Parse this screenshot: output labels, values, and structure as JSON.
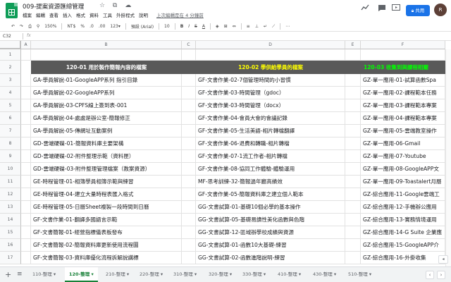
{
  "doc": {
    "title": "009-提案資源匯總管理",
    "title_icons": "☆ ⧉ ☁",
    "menus": [
      "檔案",
      "編輯",
      "查看",
      "插入",
      "格式",
      "資料",
      "工具",
      "外掛程式",
      "說明"
    ],
    "last_edit": "上次編輯是在 4 分鐘前",
    "share_label": "共用",
    "avatar_initial": "R"
  },
  "toolbar": {
    "undo": "↶",
    "redo": "↷",
    "print": "⎙",
    "paint": "⚲",
    "zoom": "150%",
    "currency": "NT$",
    "percent": "%",
    "dec_less": ".0",
    "dec_more": ".00",
    "format_more": "123▾",
    "font": "預設 (Arial)",
    "font_size": "10",
    "bold": "B",
    "italic": "I",
    "strike": "S",
    "text_color": "A",
    "more": "⋯"
  },
  "formula_bar": {
    "cell_ref": "C32",
    "fx": "fx"
  },
  "columns": [
    "A",
    "B",
    "C",
    "D",
    "E",
    "F"
  ],
  "rows": [
    "1",
    "2",
    "3",
    "4",
    "5",
    "6",
    "7",
    "8",
    "9",
    "10",
    "11",
    "12",
    "13",
    "14",
    "15",
    "16",
    "17"
  ],
  "headers": {
    "col_b": "120-01 用於製作簡報內容的檔案",
    "col_d": "120-02 學供給學員的檔案",
    "col_f": "120-03 收集到與課程相關"
  },
  "colors": {
    "header_bg": "#595959",
    "hdr_white": "#ffffff",
    "hdr_yellow": "#ffff00",
    "hdr_green": "#00ff00",
    "accent": "#188038",
    "share": "#1a73e8"
  },
  "table": [
    [
      "GA-學員解說-01-GoogleAPP系列 指引目錄",
      "GF-文書作業-02-7個管理時間的小習慣",
      "GZ-單一應用-01-試算函數Spa"
    ],
    [
      "GA-學員解說-02-GoogleAPP系列",
      "GF-文書作業-03-時間管理（gdoc）",
      "GZ-單一應用-02-課程範本任務"
    ],
    [
      "GA-學員解說-03-CPFS線上簽到表-001",
      "GF-文書作業-03-時間管理（docx）",
      "GZ-單一應用-03-課程範本專案"
    ],
    [
      "GA-學員解說-04-處處是辦公室-簡報修正",
      "GF-文書作業-04-會員大會的會議記錄",
      "GZ-單一應用-04-課程範本專案"
    ],
    [
      "GA-學員解說-05-傳網址互動案例",
      "GF-文書作業-05-生活美語-相片轉檔翻譯",
      "GZ-單一應用-05-雲端教室操作"
    ],
    [
      "GD-雲端硬碟-01-簡報資料庫主要架構",
      "GF-文書作業-06-退費和轉職-相片轉檔",
      "GZ-單一應用-06-Gmail"
    ],
    [
      "GD-雲端硬碟-02-附件整理示範（資料匣）",
      "GF-文書作業-07-1流工作者-相片轉檔",
      "GZ-單一應用-07-Youtube"
    ],
    [
      "GD-雲端硬碟-03-附件整理管理檔案（教案資源）",
      "GF-文書作業-08-協同工作體驗-體驗運用",
      "GZ-單一應用-08-GoogleAPP文"
    ],
    [
      "GE-時程管理-01-相簿學員相簿示範與練習",
      "MF-思考訓練-32-簡報過年廳高績效",
      "GZ-單一應用-09-Toastalert月曆"
    ],
    [
      "GE-時程管理-04-建立大量時程表匯入格式",
      "GF-文書作業-05-簡報資料庫之建立個人範本",
      "GZ-綜合應用-11-Google雲端工"
    ],
    [
      "GE-時程管理-05-日曆Sheet複製一段時間到日曆",
      "GG-文書試算-01-基礎10個必學的基本操作",
      "GZ-綜合應用-12-手機辦公應用"
    ],
    [
      "GF-文書作業-01-翻譯多國語言示範",
      "GG-文書試算-05-基礎易讀性美化函數與色階",
      "GZ-綜合應用-13-實務情境運用"
    ],
    [
      "GF-文書簡報-01-經營指標儀表板發布",
      "GG-文書試算-12-區域辦學校成績與資源",
      "GZ-綜合應用-14-G Suite 企業應"
    ],
    [
      "GF-文書簡報-02-簡報資料庫更新使用流程圖",
      "GG-文書試算-01-函數10大基礎-練習",
      "GZ-綜合應用-15-GoogleAPP介"
    ],
    [
      "GF-文書簡報-03-資料庫優化流程拆解說講標",
      "GG-文書試算-02-函數進階說明-練習",
      "GZ-綜合應用-16-外掛收集"
    ]
  ],
  "sheet_tabs": [
    "110-整理",
    "120-整理",
    "210-整理",
    "220-整理",
    "310-整理",
    "320-整理",
    "330-整理",
    "410-整理",
    "430-整理",
    "510-整理"
  ],
  "active_tab": "120-整理",
  "tab_add": "+",
  "tab_list": "≡",
  "scroll_left": "‹",
  "scroll_right": "›",
  "side_btn": "◂"
}
